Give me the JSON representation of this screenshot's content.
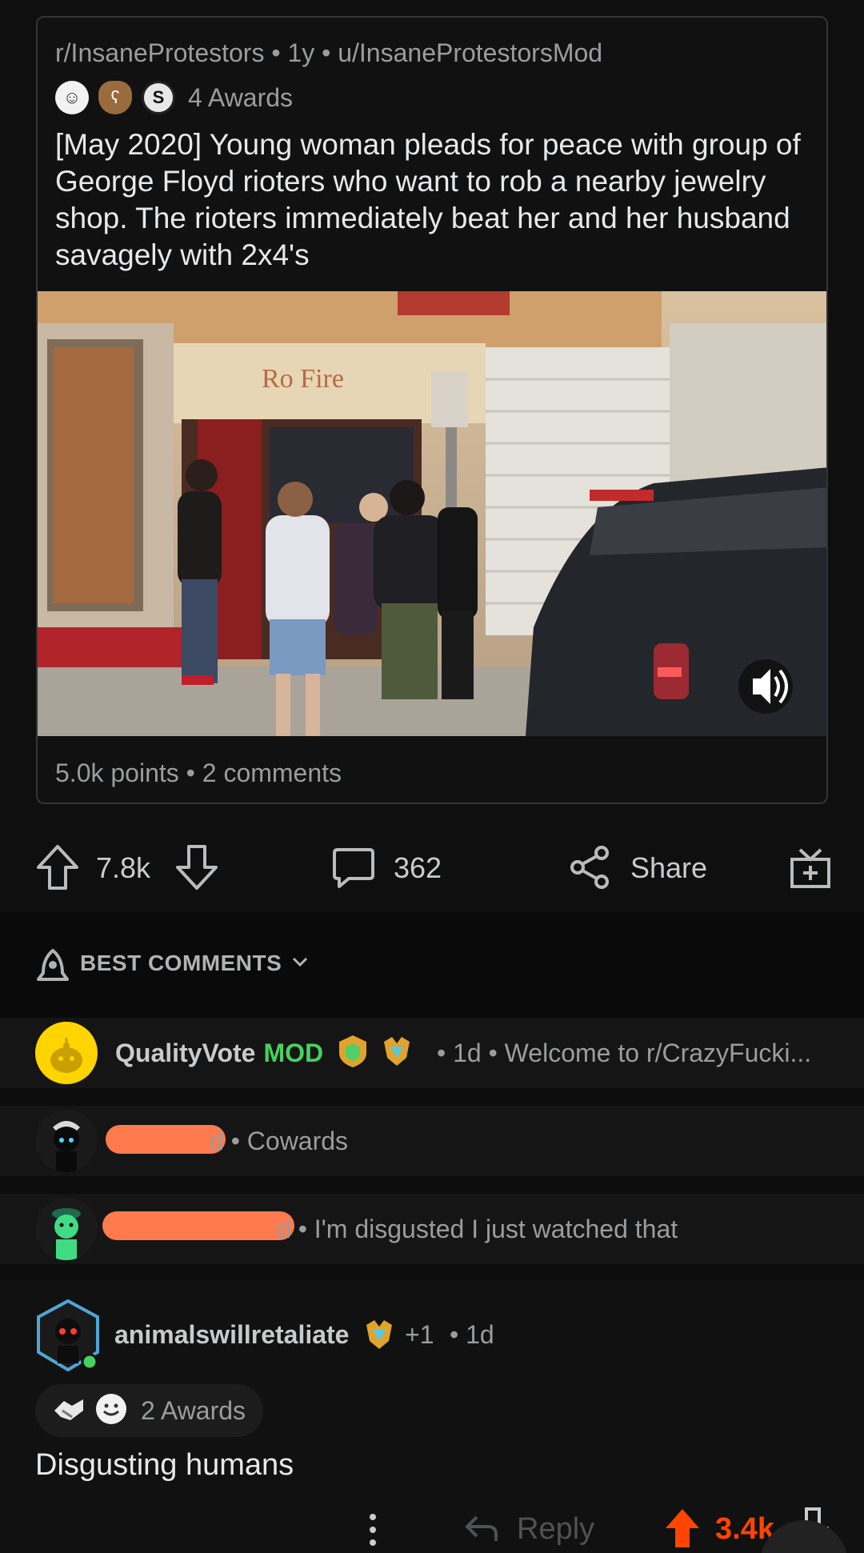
{
  "post": {
    "crosspost": {
      "meta": "r/InsaneProtestors • 1y • u/InsaneProtestorsMod",
      "awards_label": "4 Awards",
      "title": "[May 2020] Young woman pleads for peace with group of George Floyd rioters who want to rob a nearby jewelry shop. The rioters immediately beat her and her husband savagely with 2x4's",
      "footer": "5.0k points • 2 comments"
    },
    "actions": {
      "votes": "7.8k",
      "comments": "362",
      "share_label": "Share"
    }
  },
  "sort": {
    "label": "BEST COMMENTS"
  },
  "collapsed_comments": [
    {
      "user": "QualityVote",
      "mod": "MOD",
      "rest": "• 1d • Welcome to r/CrazyFucki..."
    },
    {
      "rest": "d • Cowards"
    },
    {
      "rest": "d • I'm disgusted I just watched that"
    }
  ],
  "comment": {
    "user": "animalswillretaliate",
    "plus": "+1",
    "time": "• 1d",
    "awards_label": "2 Awards",
    "body": "Disgusting humans",
    "reply_label": "Reply",
    "score": "3.4k"
  },
  "colors": {
    "accent": "#ff4500",
    "mod_green": "#46d160",
    "redaction": "#ff7a4d"
  }
}
